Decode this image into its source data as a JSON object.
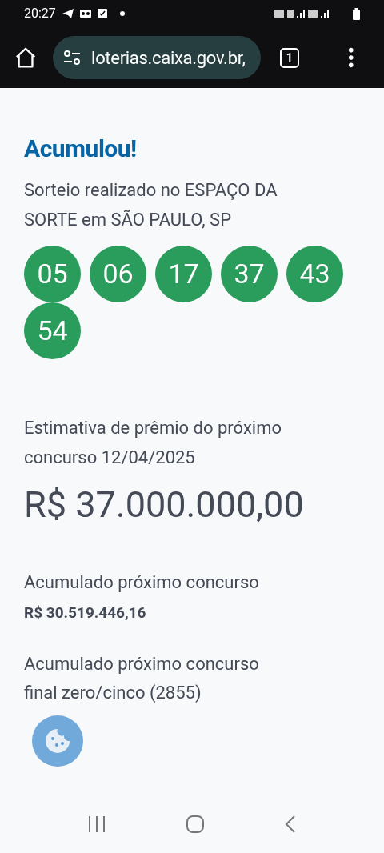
{
  "status_bar": {
    "time": "20:27"
  },
  "browser": {
    "url": "loterias.caixa.gov.br,",
    "tab_count": "1"
  },
  "result": {
    "title": "Acumulou!",
    "location": "Sorteio realizado no ESPAÇO DA SORTE em SÃO PAULO, SP",
    "numbers": [
      "05",
      "06",
      "17",
      "37",
      "43",
      "54"
    ]
  },
  "estimate": {
    "label": "Estimativa de prêmio do próximo concurso 12/04/2025",
    "value": "R$ 37.000.000,00"
  },
  "accumulated": [
    {
      "label": "Acumulado próximo concurso",
      "value": "R$ 30.519.446,16"
    },
    {
      "label": "Acumulado próximo concurso final zero/cinco (2855)"
    }
  ]
}
